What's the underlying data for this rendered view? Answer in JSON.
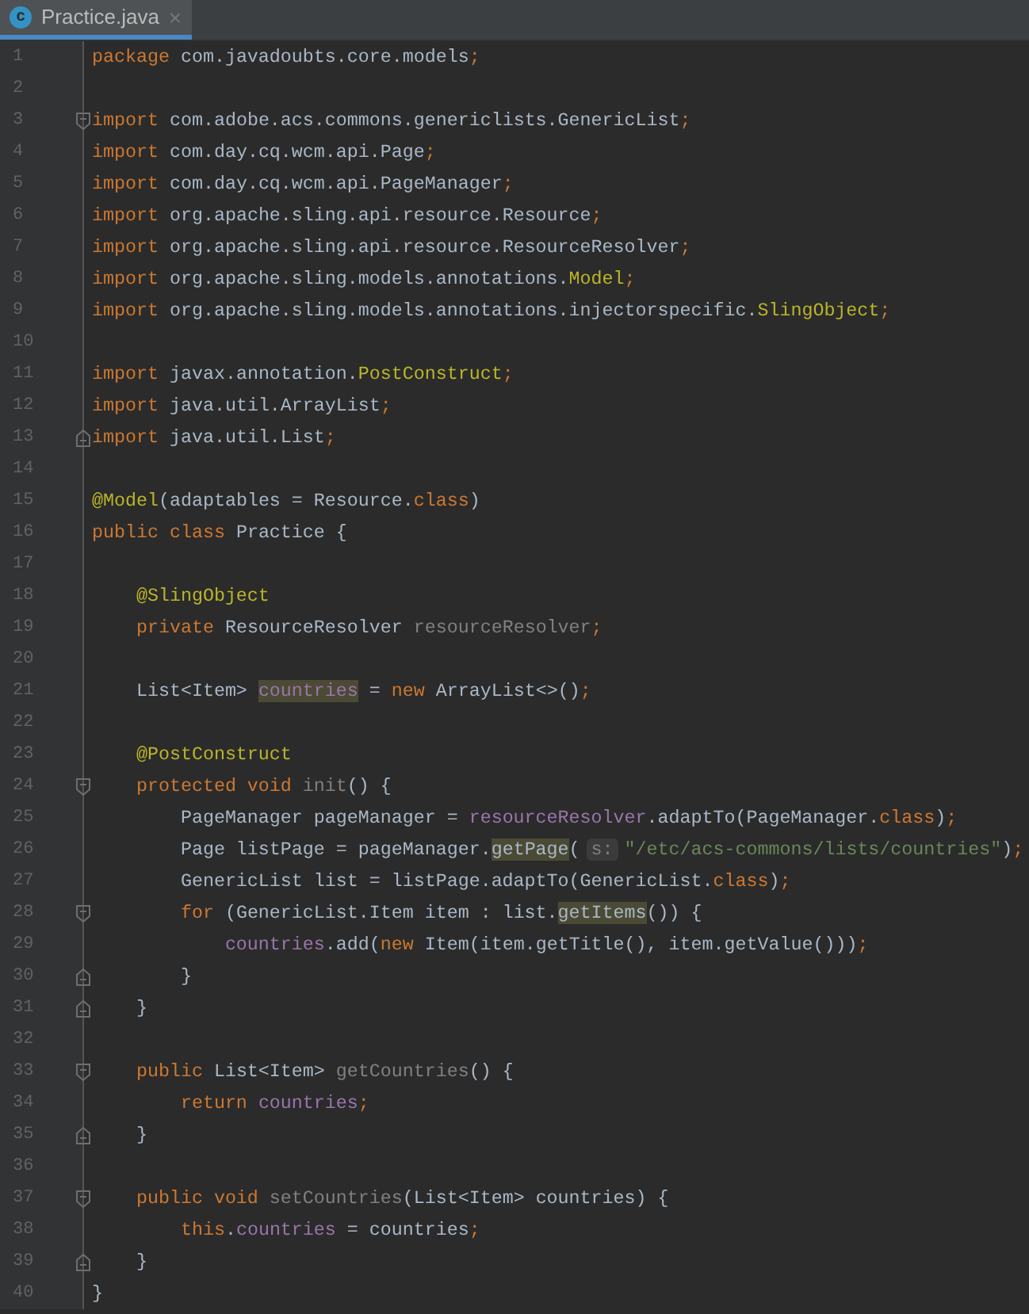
{
  "tab": {
    "title": "Practice.java",
    "icon_letter": "c",
    "close": "×",
    "selected": true
  },
  "lines": [
    {
      "number": "1",
      "tokens": [
        {
          "kind": "kw",
          "text": "package"
        },
        {
          "kind": "plain",
          "text": " com.javadoubts.core.models"
        },
        {
          "kind": "kw",
          "text": ";"
        }
      ]
    },
    {
      "number": "2"
    },
    {
      "number": "3",
      "fold_start": true,
      "tokens": [
        {
          "kind": "kw",
          "text": "import"
        },
        {
          "kind": "plain",
          "text": " com.adobe.acs.commons.genericlists.GenericList"
        },
        {
          "kind": "kw",
          "text": ";"
        }
      ]
    },
    {
      "number": "4",
      "tokens": [
        {
          "kind": "kw",
          "text": "import"
        },
        {
          "kind": "plain",
          "text": " com.day.cq.wcm.api.Page"
        },
        {
          "kind": "kw",
          "text": ";"
        }
      ]
    },
    {
      "number": "5",
      "tokens": [
        {
          "kind": "kw",
          "text": "import"
        },
        {
          "kind": "plain",
          "text": " com.day.cq.wcm.api.PageManager"
        },
        {
          "kind": "kw",
          "text": ";"
        }
      ]
    },
    {
      "number": "6",
      "tokens": [
        {
          "kind": "kw",
          "text": "import"
        },
        {
          "kind": "plain",
          "text": " org.apache.sling.api.resource.Resource"
        },
        {
          "kind": "kw",
          "text": ";"
        }
      ]
    },
    {
      "number": "7",
      "tokens": [
        {
          "kind": "kw",
          "text": "import"
        },
        {
          "kind": "plain",
          "text": " org.apache.sling.api.resource.ResourceResolver"
        },
        {
          "kind": "kw",
          "text": ";"
        }
      ]
    },
    {
      "number": "8",
      "tokens": [
        {
          "kind": "kw",
          "text": "import"
        },
        {
          "kind": "plain",
          "text": " org.apache.sling.models.annotations."
        },
        {
          "kind": "ann",
          "text": "Model"
        },
        {
          "kind": "kw",
          "text": ";"
        }
      ]
    },
    {
      "number": "9",
      "tokens": [
        {
          "kind": "kw",
          "text": "import"
        },
        {
          "kind": "plain",
          "text": " org.apache.sling.models.annotations.injectorspecific."
        },
        {
          "kind": "ann",
          "text": "SlingObject"
        },
        {
          "kind": "kw",
          "text": ";"
        }
      ]
    },
    {
      "number": "10"
    },
    {
      "number": "11",
      "tokens": [
        {
          "kind": "kw",
          "text": "import"
        },
        {
          "kind": "plain",
          "text": " javax.annotation."
        },
        {
          "kind": "ann",
          "text": "PostConstruct"
        },
        {
          "kind": "kw",
          "text": ";"
        }
      ]
    },
    {
      "number": "12",
      "tokens": [
        {
          "kind": "kw",
          "text": "import"
        },
        {
          "kind": "plain",
          "text": " java.util.ArrayList"
        },
        {
          "kind": "kw",
          "text": ";"
        }
      ]
    },
    {
      "number": "13",
      "fold_end": true,
      "tokens": [
        {
          "kind": "kw",
          "text": "import"
        },
        {
          "kind": "plain",
          "text": " java.util.List"
        },
        {
          "kind": "kw",
          "text": ";"
        }
      ]
    },
    {
      "number": "14"
    },
    {
      "number": "15",
      "tokens": [
        {
          "kind": "ann",
          "text": "@Model"
        },
        {
          "kind": "plain",
          "text": "(adaptables = Resource."
        },
        {
          "kind": "kw",
          "text": "class"
        },
        {
          "kind": "plain",
          "text": ")"
        }
      ]
    },
    {
      "number": "16",
      "tokens": [
        {
          "kind": "kw",
          "text": "public class"
        },
        {
          "kind": "plain",
          "text": " Practice {"
        }
      ]
    },
    {
      "number": "17"
    },
    {
      "number": "18",
      "tokens": [
        {
          "kind": "ann",
          "text": "    @SlingObject"
        }
      ]
    },
    {
      "number": "19",
      "tokens": [
        {
          "kind": "kw",
          "text": "    private"
        },
        {
          "kind": "plain",
          "text": " ResourceResolver "
        },
        {
          "kind": "gray",
          "text": "resourceResolver"
        },
        {
          "kind": "kw",
          "text": ";"
        }
      ]
    },
    {
      "number": "20"
    },
    {
      "number": "21",
      "tokens": [
        {
          "kind": "plain",
          "text": "    List<Item> "
        },
        {
          "kind": "hl",
          "text": "countries"
        },
        {
          "kind": "plain",
          "text": " = "
        },
        {
          "kind": "kw",
          "text": "new"
        },
        {
          "kind": "plain",
          "text": " ArrayList<>()"
        },
        {
          "kind": "kw",
          "text": ";"
        }
      ]
    },
    {
      "number": "22"
    },
    {
      "number": "23",
      "tokens": [
        {
          "kind": "ann",
          "text": "    @PostConstruct"
        }
      ]
    },
    {
      "number": "24",
      "fold_start": true,
      "tokens": [
        {
          "kind": "kw",
          "text": "    protected void "
        },
        {
          "kind": "gray",
          "text": "init"
        },
        {
          "kind": "plain",
          "text": "() {"
        }
      ]
    },
    {
      "number": "25",
      "tokens": [
        {
          "kind": "plain",
          "text": "        PageManager pageManager = "
        },
        {
          "kind": "field",
          "text": "resourceResolver"
        },
        {
          "kind": "plain",
          "text": ".adaptTo(PageManager."
        },
        {
          "kind": "kw",
          "text": "class"
        },
        {
          "kind": "plain",
          "text": ")"
        },
        {
          "kind": "kw",
          "text": ";"
        }
      ]
    },
    {
      "number": "26",
      "tokens": [
        {
          "kind": "plain",
          "text": "        Page listPage = pageManager."
        },
        {
          "kind": "mhl",
          "text": "getPage"
        },
        {
          "kind": "plain",
          "text": "("
        },
        {
          "kind": "hint",
          "text": "s:"
        },
        {
          "kind": "str",
          "text": "\"/etc/acs-commons/lists/countries\""
        },
        {
          "kind": "plain",
          "text": ")"
        },
        {
          "kind": "kw",
          "text": ";"
        }
      ]
    },
    {
      "number": "27",
      "tokens": [
        {
          "kind": "plain",
          "text": "        GenericList list = listPage.adaptTo(GenericList."
        },
        {
          "kind": "kw",
          "text": "class"
        },
        {
          "kind": "plain",
          "text": ")"
        },
        {
          "kind": "kw",
          "text": ";"
        }
      ]
    },
    {
      "number": "28",
      "fold_start": true,
      "tokens": [
        {
          "kind": "kw",
          "text": "        for"
        },
        {
          "kind": "plain",
          "text": " (GenericList.Item item : list."
        },
        {
          "kind": "mhl",
          "text": "getItems"
        },
        {
          "kind": "plain",
          "text": "()) {"
        }
      ]
    },
    {
      "number": "29",
      "tokens": [
        {
          "kind": "field",
          "text": "            countries"
        },
        {
          "kind": "plain",
          "text": ".add("
        },
        {
          "kind": "kw",
          "text": "new"
        },
        {
          "kind": "plain",
          "text": " Item(item.getTitle(), item.getValue()))"
        },
        {
          "kind": "kw",
          "text": ";"
        }
      ]
    },
    {
      "number": "30",
      "fold_end": true,
      "tokens": [
        {
          "kind": "plain",
          "text": "        }"
        }
      ]
    },
    {
      "number": "31",
      "fold_end": true,
      "tokens": [
        {
          "kind": "plain",
          "text": "    }"
        }
      ]
    },
    {
      "number": "32"
    },
    {
      "number": "33",
      "fold_start": true,
      "tokens": [
        {
          "kind": "kw",
          "text": "    public"
        },
        {
          "kind": "plain",
          "text": " List<Item> "
        },
        {
          "kind": "gray",
          "text": "getCountries"
        },
        {
          "kind": "plain",
          "text": "() {"
        }
      ]
    },
    {
      "number": "34",
      "tokens": [
        {
          "kind": "kw",
          "text": "        return "
        },
        {
          "kind": "field",
          "text": "countries"
        },
        {
          "kind": "kw",
          "text": ";"
        }
      ]
    },
    {
      "number": "35",
      "fold_end": true,
      "tokens": [
        {
          "kind": "plain",
          "text": "    }"
        }
      ]
    },
    {
      "number": "36"
    },
    {
      "number": "37",
      "fold_start": true,
      "tokens": [
        {
          "kind": "kw",
          "text": "    public void "
        },
        {
          "kind": "gray",
          "text": "setCountries"
        },
        {
          "kind": "plain",
          "text": "(List<Item> countries) {"
        }
      ]
    },
    {
      "number": "38",
      "tokens": [
        {
          "kind": "kw",
          "text": "        this"
        },
        {
          "kind": "plain",
          "text": "."
        },
        {
          "kind": "field",
          "text": "countries"
        },
        {
          "kind": "plain",
          "text": " = countries"
        },
        {
          "kind": "kw",
          "text": ";"
        }
      ]
    },
    {
      "number": "39",
      "fold_end": true,
      "tokens": [
        {
          "kind": "plain",
          "text": "    }"
        }
      ]
    },
    {
      "number": "40",
      "tokens": [
        {
          "kind": "plain",
          "text": "}"
        }
      ]
    }
  ]
}
